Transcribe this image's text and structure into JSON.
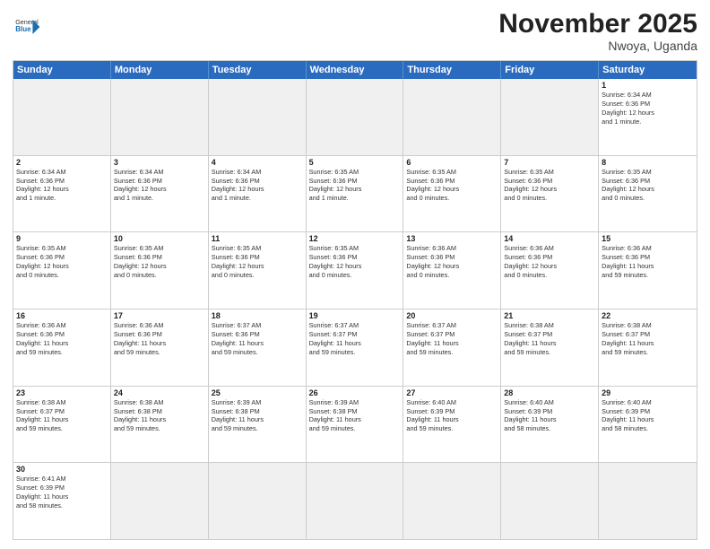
{
  "header": {
    "logo_general": "General",
    "logo_blue": "Blue",
    "month_title": "November 2025",
    "location": "Nwoya, Uganda"
  },
  "weekdays": [
    "Sunday",
    "Monday",
    "Tuesday",
    "Wednesday",
    "Thursday",
    "Friday",
    "Saturday"
  ],
  "weeks": [
    [
      {
        "day": "",
        "text": "",
        "empty": true
      },
      {
        "day": "",
        "text": "",
        "empty": true
      },
      {
        "day": "",
        "text": "",
        "empty": true
      },
      {
        "day": "",
        "text": "",
        "empty": true
      },
      {
        "day": "",
        "text": "",
        "empty": true
      },
      {
        "day": "",
        "text": "",
        "empty": true
      },
      {
        "day": "1",
        "text": "Sunrise: 6:34 AM\nSunset: 6:36 PM\nDaylight: 12 hours\nand 1 minute."
      }
    ],
    [
      {
        "day": "2",
        "text": "Sunrise: 6:34 AM\nSunset: 6:36 PM\nDaylight: 12 hours\nand 1 minute."
      },
      {
        "day": "3",
        "text": "Sunrise: 6:34 AM\nSunset: 6:36 PM\nDaylight: 12 hours\nand 1 minute."
      },
      {
        "day": "4",
        "text": "Sunrise: 6:34 AM\nSunset: 6:36 PM\nDaylight: 12 hours\nand 1 minute."
      },
      {
        "day": "5",
        "text": "Sunrise: 6:35 AM\nSunset: 6:36 PM\nDaylight: 12 hours\nand 1 minute."
      },
      {
        "day": "6",
        "text": "Sunrise: 6:35 AM\nSunset: 6:36 PM\nDaylight: 12 hours\nand 0 minutes."
      },
      {
        "day": "7",
        "text": "Sunrise: 6:35 AM\nSunset: 6:36 PM\nDaylight: 12 hours\nand 0 minutes."
      },
      {
        "day": "8",
        "text": "Sunrise: 6:35 AM\nSunset: 6:36 PM\nDaylight: 12 hours\nand 0 minutes."
      }
    ],
    [
      {
        "day": "9",
        "text": "Sunrise: 6:35 AM\nSunset: 6:36 PM\nDaylight: 12 hours\nand 0 minutes."
      },
      {
        "day": "10",
        "text": "Sunrise: 6:35 AM\nSunset: 6:36 PM\nDaylight: 12 hours\nand 0 minutes."
      },
      {
        "day": "11",
        "text": "Sunrise: 6:35 AM\nSunset: 6:36 PM\nDaylight: 12 hours\nand 0 minutes."
      },
      {
        "day": "12",
        "text": "Sunrise: 6:35 AM\nSunset: 6:36 PM\nDaylight: 12 hours\nand 0 minutes."
      },
      {
        "day": "13",
        "text": "Sunrise: 6:36 AM\nSunset: 6:36 PM\nDaylight: 12 hours\nand 0 minutes."
      },
      {
        "day": "14",
        "text": "Sunrise: 6:36 AM\nSunset: 6:36 PM\nDaylight: 12 hours\nand 0 minutes."
      },
      {
        "day": "15",
        "text": "Sunrise: 6:36 AM\nSunset: 6:36 PM\nDaylight: 11 hours\nand 59 minutes."
      }
    ],
    [
      {
        "day": "16",
        "text": "Sunrise: 6:36 AM\nSunset: 6:36 PM\nDaylight: 11 hours\nand 59 minutes."
      },
      {
        "day": "17",
        "text": "Sunrise: 6:36 AM\nSunset: 6:36 PM\nDaylight: 11 hours\nand 59 minutes."
      },
      {
        "day": "18",
        "text": "Sunrise: 6:37 AM\nSunset: 6:36 PM\nDaylight: 11 hours\nand 59 minutes."
      },
      {
        "day": "19",
        "text": "Sunrise: 6:37 AM\nSunset: 6:37 PM\nDaylight: 11 hours\nand 59 minutes."
      },
      {
        "day": "20",
        "text": "Sunrise: 6:37 AM\nSunset: 6:37 PM\nDaylight: 11 hours\nand 59 minutes."
      },
      {
        "day": "21",
        "text": "Sunrise: 6:38 AM\nSunset: 6:37 PM\nDaylight: 11 hours\nand 59 minutes."
      },
      {
        "day": "22",
        "text": "Sunrise: 6:38 AM\nSunset: 6:37 PM\nDaylight: 11 hours\nand 59 minutes."
      }
    ],
    [
      {
        "day": "23",
        "text": "Sunrise: 6:38 AM\nSunset: 6:37 PM\nDaylight: 11 hours\nand 59 minutes."
      },
      {
        "day": "24",
        "text": "Sunrise: 6:38 AM\nSunset: 6:38 PM\nDaylight: 11 hours\nand 59 minutes."
      },
      {
        "day": "25",
        "text": "Sunrise: 6:39 AM\nSunset: 6:38 PM\nDaylight: 11 hours\nand 59 minutes."
      },
      {
        "day": "26",
        "text": "Sunrise: 6:39 AM\nSunset: 6:38 PM\nDaylight: 11 hours\nand 59 minutes."
      },
      {
        "day": "27",
        "text": "Sunrise: 6:40 AM\nSunset: 6:39 PM\nDaylight: 11 hours\nand 59 minutes."
      },
      {
        "day": "28",
        "text": "Sunrise: 6:40 AM\nSunset: 6:39 PM\nDaylight: 11 hours\nand 58 minutes."
      },
      {
        "day": "29",
        "text": "Sunrise: 6:40 AM\nSunset: 6:39 PM\nDaylight: 11 hours\nand 58 minutes."
      }
    ],
    [
      {
        "day": "30",
        "text": "Sunrise: 6:41 AM\nSunset: 6:39 PM\nDaylight: 11 hours\nand 58 minutes."
      },
      {
        "day": "",
        "text": "",
        "empty": true
      },
      {
        "day": "",
        "text": "",
        "empty": true
      },
      {
        "day": "",
        "text": "",
        "empty": true
      },
      {
        "day": "",
        "text": "",
        "empty": true
      },
      {
        "day": "",
        "text": "",
        "empty": true
      },
      {
        "day": "",
        "text": "",
        "empty": true
      }
    ]
  ]
}
